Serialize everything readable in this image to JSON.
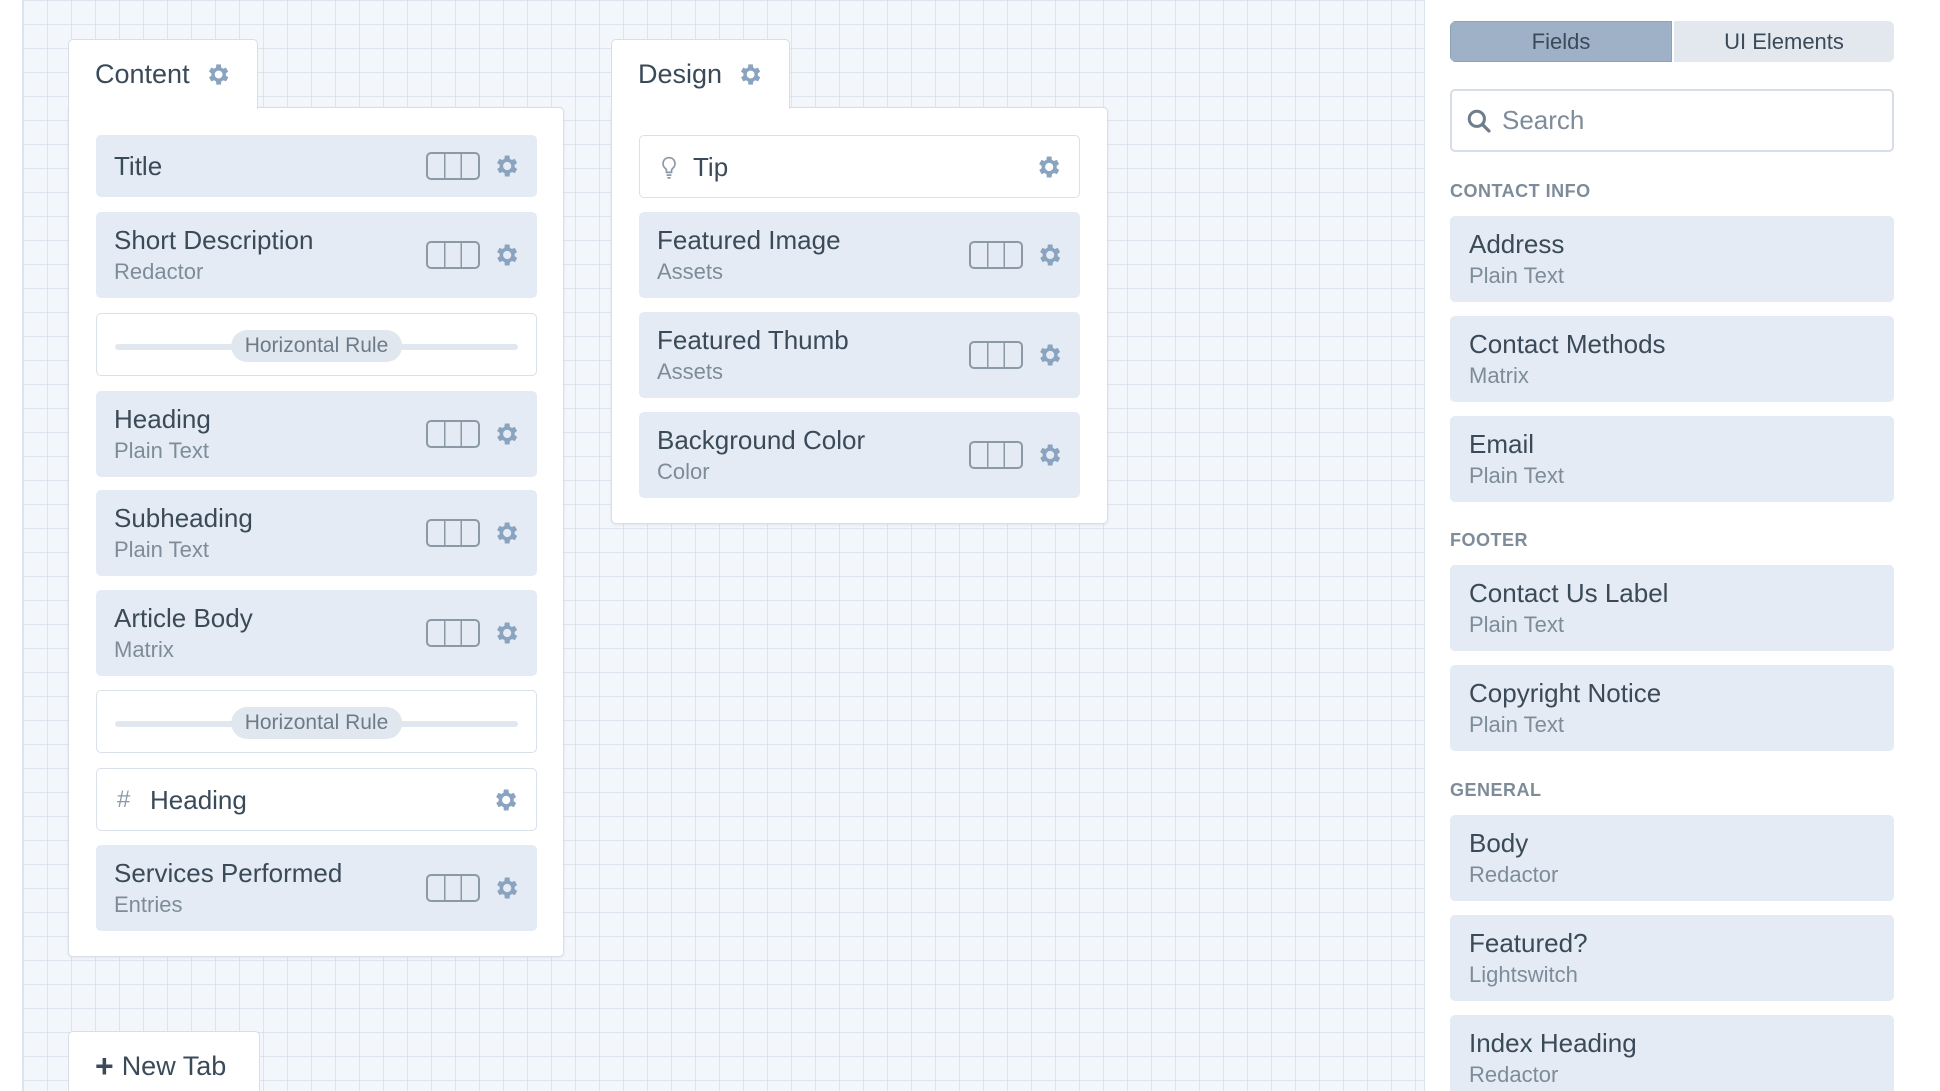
{
  "tabs": [
    {
      "name": "Content",
      "items": [
        {
          "kind": "field",
          "name": "Title",
          "type": ""
        },
        {
          "kind": "field",
          "name": "Short Description",
          "type": "Redactor"
        },
        {
          "kind": "hr",
          "label": "Horizontal Rule"
        },
        {
          "kind": "field",
          "name": "Heading",
          "type": "Plain Text"
        },
        {
          "kind": "field",
          "name": "Subheading",
          "type": "Plain Text"
        },
        {
          "kind": "field",
          "name": "Article Body",
          "type": "Matrix"
        },
        {
          "kind": "hr",
          "label": "Horizontal Rule"
        },
        {
          "kind": "heading",
          "icon": "#",
          "name": "Heading"
        },
        {
          "kind": "field",
          "name": "Services Performed",
          "type": "Entries"
        }
      ]
    },
    {
      "name": "Design",
      "items": [
        {
          "kind": "tip",
          "name": "Tip"
        },
        {
          "kind": "field",
          "name": "Featured Image",
          "type": "Assets"
        },
        {
          "kind": "field",
          "name": "Featured Thumb",
          "type": "Assets"
        },
        {
          "kind": "field",
          "name": "Background Color",
          "type": "Color"
        }
      ]
    }
  ],
  "new_tab_label": "New Tab",
  "sidebar": {
    "segments": [
      {
        "label": "Fields",
        "active": true
      },
      {
        "label": "UI Elements",
        "active": false
      }
    ],
    "search_placeholder": "Search",
    "groups": [
      {
        "title": "CONTACT INFO",
        "fields": [
          {
            "name": "Address",
            "type": "Plain Text"
          },
          {
            "name": "Contact Methods",
            "type": "Matrix"
          },
          {
            "name": "Email",
            "type": "Plain Text"
          }
        ]
      },
      {
        "title": "FOOTER",
        "fields": [
          {
            "name": "Contact Us Label",
            "type": "Plain Text"
          },
          {
            "name": "Copyright Notice",
            "type": "Plain Text"
          }
        ]
      },
      {
        "title": "GENERAL",
        "fields": [
          {
            "name": "Body",
            "type": "Redactor"
          },
          {
            "name": "Featured?",
            "type": "Lightswitch"
          },
          {
            "name": "Index Heading",
            "type": "Redactor"
          }
        ]
      }
    ]
  },
  "colors": {
    "gear": "#8aa3bf",
    "active_segment": "#9fb1c7",
    "field_bg": "#e4ebf4"
  }
}
